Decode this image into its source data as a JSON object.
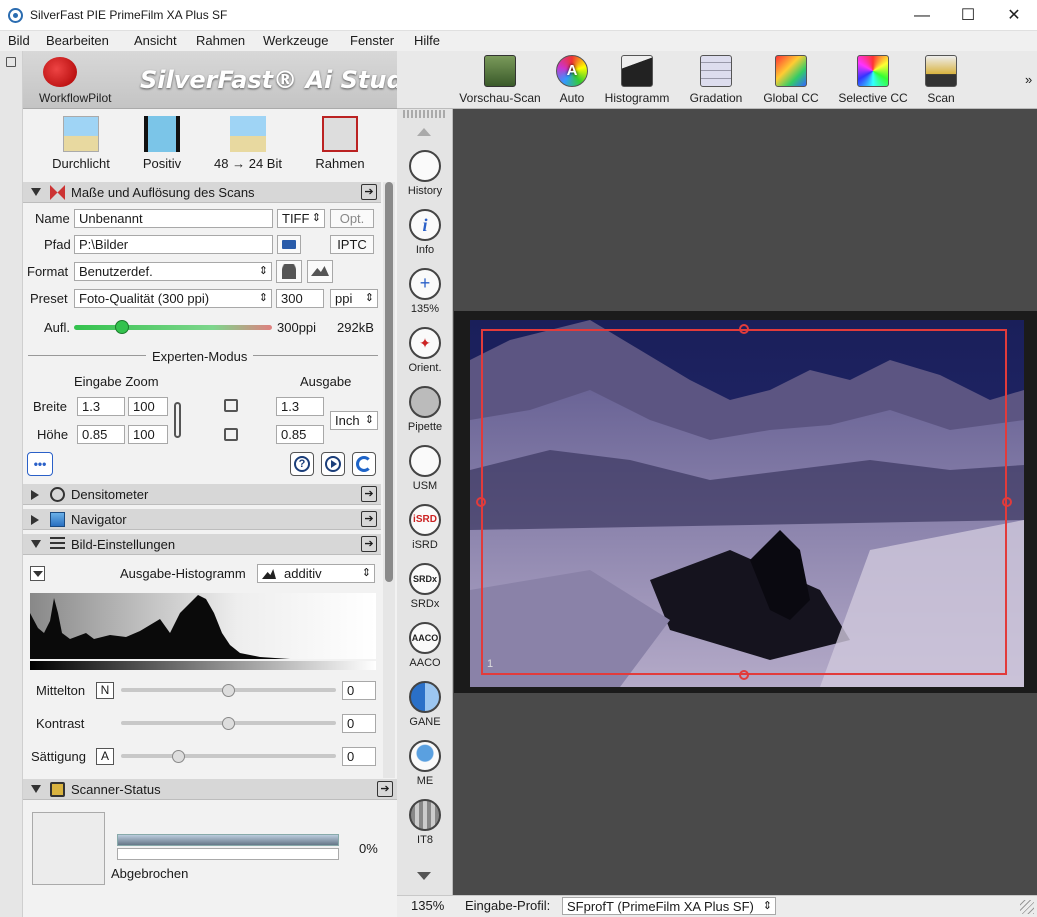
{
  "window": {
    "title": "SilverFast  PIE PrimeFilm XA Plus SF",
    "minimize": "—",
    "maximize": "☐",
    "close": "✕"
  },
  "menu": [
    "Bild",
    "Bearbeiten",
    "Ansicht",
    "Rahmen",
    "Werkzeuge",
    "Fenster",
    "Hilfe"
  ],
  "brand": {
    "workflowpilot": "WorkflowPilot",
    "product": "SilverFast® Ai Studio"
  },
  "toolbar": [
    {
      "label": "Vorschau-Scan",
      "icon": "preview-scan-icon"
    },
    {
      "label": "Auto",
      "icon": "auto-icon"
    },
    {
      "label": "Histogramm",
      "icon": "histogram-icon"
    },
    {
      "label": "Gradation",
      "icon": "gradation-icon"
    },
    {
      "label": "Global CC",
      "icon": "global-cc-icon"
    },
    {
      "label": "Selective CC",
      "icon": "selective-cc-icon"
    },
    {
      "label": "Scan",
      "icon": "scan-icon"
    }
  ],
  "toolbar_more": "»",
  "quick": [
    {
      "label": "Durchlicht",
      "icon": "transmitted-light-icon"
    },
    {
      "label": "Positiv",
      "icon": "positive-film-icon"
    },
    {
      "label": "48 → 24 Bit",
      "icon": "bit-depth-icon"
    },
    {
      "label": "Rahmen",
      "icon": "frame-tool-icon"
    }
  ],
  "scan_settings": {
    "header": "Maße und Auflösung des Scans",
    "name_label": "Name",
    "name_value": "Unbenannt",
    "filetype": "TIFF",
    "opt": "Opt.",
    "path_label": "Pfad",
    "path_value": "P:\\Bilder",
    "iptc": "IPTC",
    "format_label": "Format",
    "format_value": "Benutzerdef.",
    "preset_label": "Preset",
    "preset_value": "Foto-Qualität (300 ppi)",
    "ppi_value": "300",
    "ppi_unit": "ppi",
    "resolution_label": "Aufl.",
    "resolution_value": "300ppi",
    "size_value": "292kB",
    "expert_mode": "Experten-Modus",
    "input_zoom": "Eingabe Zoom",
    "output": "Ausgabe",
    "width_label": "Breite",
    "width_in": "1.3",
    "width_zoom": "100",
    "width_out": "1.3",
    "height_label": "Höhe",
    "height_in": "0.85",
    "height_zoom": "100",
    "height_out": "0.85",
    "unit": "Inch",
    "more": "•••"
  },
  "sections": {
    "densitometer": "Densitometer",
    "navigator": "Navigator",
    "image_settings": "Bild-Einstellungen",
    "scanner_status": "Scanner-Status"
  },
  "image_settings": {
    "histogram_label": "Ausgabe-Histogramm",
    "histogram_mode": "additiv",
    "midtone_label": "Mittelton",
    "midtone_badge": "N",
    "midtone_value": "0",
    "contrast_label": "Kontrast",
    "contrast_value": "0",
    "saturation_label": "Sättigung",
    "saturation_badge": "A",
    "saturation_value": "0",
    "slider_levels": {
      "midtone": 0.5,
      "contrast": 0.5,
      "saturation": 0.27
    }
  },
  "scanner_status": {
    "percent": "0%",
    "status_text": "Abgebrochen"
  },
  "sidebar": [
    {
      "label": "History",
      "icon": "history-icon"
    },
    {
      "label": "Info",
      "icon": "info-icon"
    },
    {
      "label": "135%",
      "icon": "zoom-icon"
    },
    {
      "label": "Orient.",
      "icon": "orientation-icon"
    },
    {
      "label": "Pipette",
      "icon": "pipette-icon"
    },
    {
      "label": "USM",
      "icon": "usm-icon"
    },
    {
      "label": "iSRD",
      "icon": "isrd-icon"
    },
    {
      "label": "SRDx",
      "icon": "srdx-icon"
    },
    {
      "label": "AACO",
      "icon": "aaco-icon"
    },
    {
      "label": "GANE",
      "icon": "gane-icon"
    },
    {
      "label": "ME",
      "icon": "me-icon"
    },
    {
      "label": "IT8",
      "icon": "it8-icon"
    }
  ],
  "frame_number": "1",
  "statusbar": {
    "zoom": "135%",
    "profile_label": "Eingabe-Profil:",
    "profile_value": "SFprofT (PrimeFilm XA Plus SF)"
  },
  "colors": {
    "frame_red": "#e23b3b",
    "slider_green": "#33c24d",
    "canvas_bg": "#4a4a4a"
  }
}
